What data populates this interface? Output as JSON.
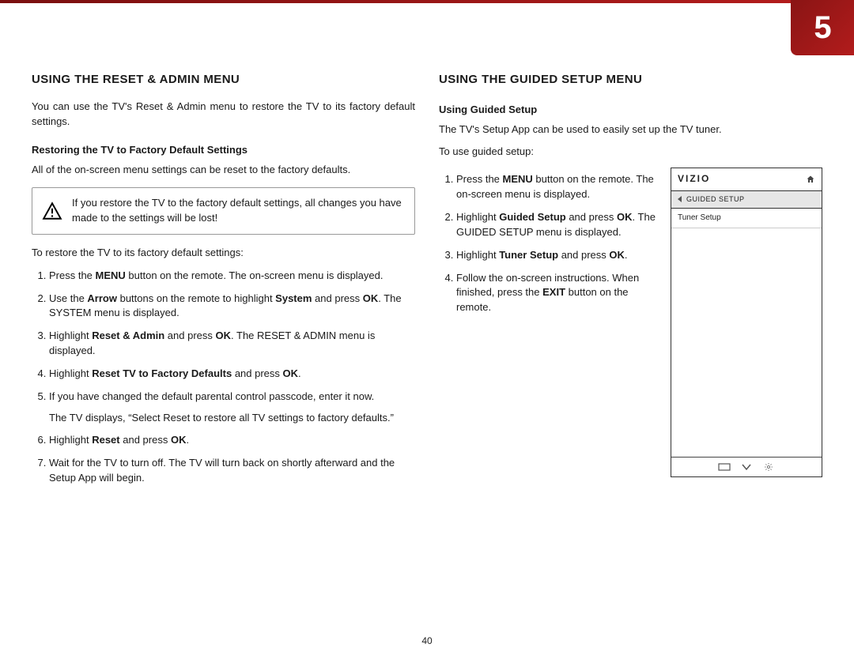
{
  "chapter_number": "5",
  "page_number": "40",
  "left": {
    "heading": "USING THE RESET & ADMIN MENU",
    "intro": "You can use the TV's Reset & Admin menu to restore the TV to its factory default settings.",
    "sub1_title": "Restoring the TV to Factory Default Settings",
    "sub1_intro": "All of the on-screen menu settings can be reset to the factory defaults.",
    "callout": "If you restore the TV to the factory default settings, all changes you have made to the settings will be lost!",
    "restore_lead": "To restore the TV to its factory default settings:",
    "steps": [
      {
        "pre": "Press the ",
        "b1": "MENU",
        "mid": " button on the remote. The on-screen menu is displayed."
      },
      {
        "pre": "Use the ",
        "b1": "Arrow",
        "mid": " buttons on the remote to highlight ",
        "b2": "System",
        "post": " and press ",
        "b3": "OK",
        "tail": ". The SYSTEM menu is displayed."
      },
      {
        "pre": "Highlight ",
        "b1": "Reset & Admin",
        "mid": " and press ",
        "b2": "OK",
        "post": ". The RESET & ADMIN menu is displayed."
      },
      {
        "pre": "Highlight ",
        "b1": "Reset TV to Factory Defaults",
        "mid": " and press ",
        "b2": "OK",
        "post": "."
      },
      {
        "pre": "If you have changed the default parental control passcode, enter it now.",
        "sub": "The TV displays, “Select Reset to restore all TV settings to factory defaults.”"
      },
      {
        "pre": "Highlight ",
        "b1": "Reset",
        "mid": " and press ",
        "b2": "OK",
        "post": "."
      },
      {
        "pre": "Wait for the TV to turn off. The TV will turn back on shortly afterward and the Setup App will begin."
      }
    ]
  },
  "right": {
    "heading": "USING THE GUIDED SETUP MENU",
    "sub_title": "Using Guided Setup",
    "sub_intro": "The TV's Setup App can be used to easily set up the TV tuner.",
    "lead": "To use guided setup:",
    "steps": [
      {
        "pre": "Press the ",
        "b1": "MENU",
        "mid": " button on the remote. The on-screen menu is displayed."
      },
      {
        "pre": "Highlight ",
        "b1": "Guided Setup",
        "mid": " and press ",
        "b2": "OK",
        "post": ". The GUIDED SETUP menu is displayed."
      },
      {
        "pre": "Highlight ",
        "b1": "Tuner Setup",
        "mid": " and press ",
        "b2": "OK",
        "post": "."
      },
      {
        "pre": "Follow the on-screen instructions. When finished, press the ",
        "b1": "EXIT",
        "mid": " button on the remote."
      }
    ],
    "tv_menu": {
      "brand": "VIZIO",
      "crumb": "GUIDED SETUP",
      "item": "Tuner Setup"
    }
  }
}
